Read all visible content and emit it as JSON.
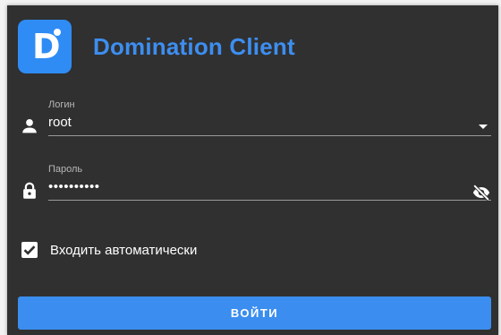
{
  "app": {
    "title": "Domination Client",
    "logo_letter": "D"
  },
  "login_field": {
    "label": "Логин",
    "value": "root",
    "icon": "person-icon"
  },
  "password_field": {
    "label": "Пароль",
    "value": "••••••••••",
    "icon": "lock-icon",
    "toggle_icon": "eye-off-icon"
  },
  "auto_login": {
    "label": "Входить автоматически",
    "checked": true
  },
  "submit": {
    "label": "ВОЙТИ"
  },
  "colors": {
    "background": "#303030",
    "accent": "#3b8ef0",
    "text": "#ffffff",
    "label": "#b7b7b7"
  }
}
